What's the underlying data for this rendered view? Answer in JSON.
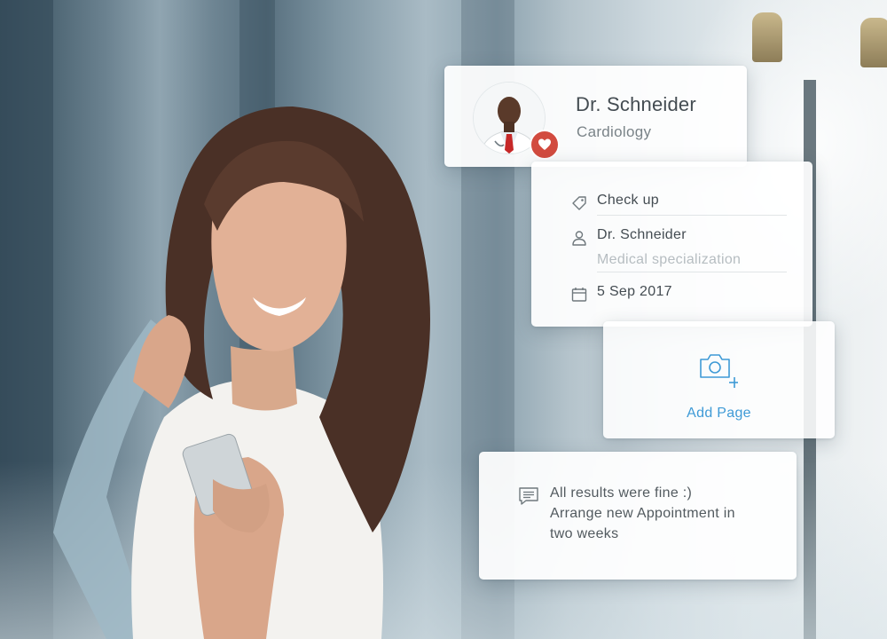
{
  "doctor_card": {
    "name": "Dr. Schneider",
    "department": "Cardiology",
    "avatar": "doctor-portrait",
    "badge_icon": "heart-icon",
    "badge_color": "#d24b3f"
  },
  "appointment_card": {
    "type": {
      "icon": "tag-icon",
      "label": "Check up"
    },
    "doctor": {
      "icon": "person-icon",
      "label": "Dr. Schneider",
      "placeholder": "Medical specialization"
    },
    "date": {
      "icon": "calendar-icon",
      "label": "5 Sep 2017"
    }
  },
  "add_page_card": {
    "icon": "camera-add-icon",
    "label": "Add Page",
    "accent_color": "#3e9ad6"
  },
  "note_card": {
    "icon": "comment-icon",
    "lines": [
      "All results were fine  :)",
      "Arrange new Appointment in",
      "two weeks"
    ]
  }
}
